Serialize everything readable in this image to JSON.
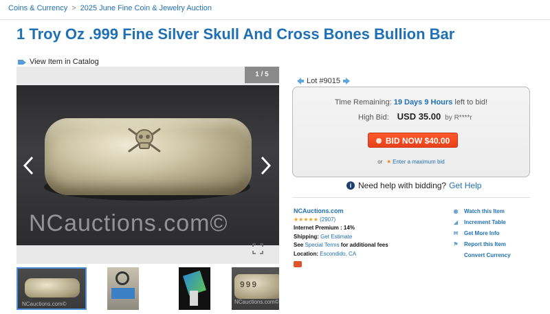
{
  "breadcrumb": {
    "items": [
      "Coins & Currency",
      "2025 June Fine Coin & Jewelry Auction"
    ],
    "separator": ">"
  },
  "title": "1 Troy Oz .999 Fine Silver Skull And Cross Bones Bullion Bar",
  "catalog_link": "View Item in Catalog",
  "gallery": {
    "counter": "1 / 5",
    "watermark": "NCauctions.com©",
    "thumbs": [
      {
        "watermark": "NCauctions.com©"
      },
      {
        "watermark": ""
      },
      {
        "watermark": ""
      },
      {
        "watermark": "NCauctions.com©",
        "stamp": "999"
      }
    ]
  },
  "lot": {
    "label": "Lot #9015"
  },
  "bidding": {
    "time_label": "Time Remaining:",
    "time_value": "19 Days 9 Hours",
    "time_suffix": "left to bid!",
    "high_bid_label": "High Bid:",
    "high_bid_amount": "USD 35.00",
    "high_bid_by": "by R****r",
    "bid_button": "BID NOW $40.00",
    "max_bid_or": "or",
    "max_bid_link": "Enter a maximum bid"
  },
  "help": {
    "text": "Need help with bidding?",
    "link": "Get Help"
  },
  "seller": {
    "name": "NCAuctions.com",
    "stars": "★★★★★",
    "rating_count": "(2907)",
    "premium_label": "Internet Premium :",
    "premium_value": "14%",
    "shipping_label": "Shipping:",
    "shipping_value": "Get Estimate",
    "terms_pre": "See",
    "terms_link": "Special Terms",
    "terms_post": "for additional fees",
    "location_label": "Location:",
    "location_value": "Escondido, CA"
  },
  "actions": [
    {
      "label": "Watch this Item",
      "icon": "eye-icon"
    },
    {
      "label": "Increment Table",
      "icon": "increment-icon"
    },
    {
      "label": "Get More Info",
      "icon": "mail-icon"
    },
    {
      "label": "Report this Item",
      "icon": "flag-icon"
    },
    {
      "label": "Convert Currency",
      "icon": ""
    }
  ],
  "colors": {
    "link": "#1f6fb5",
    "bid_button": "#e8401a",
    "stars": "#f0a020",
    "counter_bg": "#8a8a8a"
  }
}
